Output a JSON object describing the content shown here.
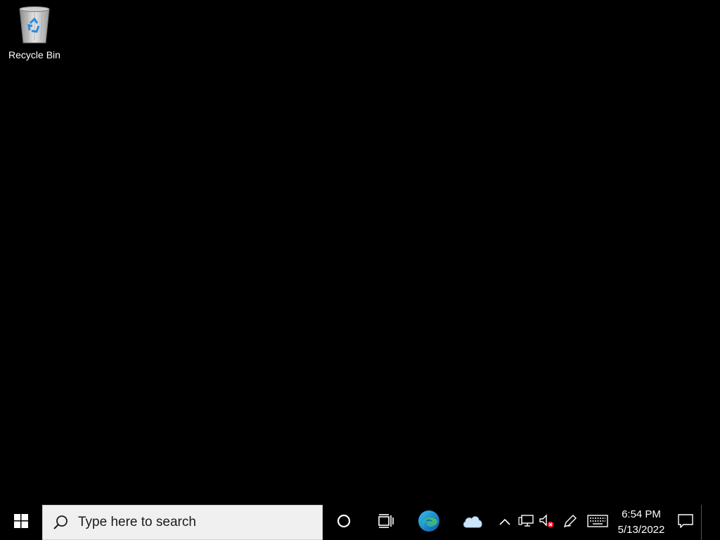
{
  "desktop": {
    "background_color": "#000000",
    "icons": [
      {
        "label": "Recycle Bin",
        "icon": "recycle-bin-icon"
      }
    ]
  },
  "taskbar": {
    "start": {
      "icon": "windows-logo-icon"
    },
    "search": {
      "placeholder": "Type here to search",
      "icon": "search-icon"
    },
    "cortana": {
      "icon": "cortana-circle-icon"
    },
    "task_view": {
      "icon": "task-view-icon"
    },
    "pinned": [
      {
        "name": "Microsoft Edge",
        "icon": "edge-icon"
      },
      {
        "name": "OneDrive",
        "icon": "onedrive-cloud-icon"
      }
    ],
    "tray": {
      "icons": [
        "show-hidden-icons-chevron",
        "network-icon",
        "volume-muted-icon",
        "pen-icon",
        "touch-keyboard-icon"
      ],
      "clock": {
        "time": "6:54 PM",
        "date": "5/13/2022"
      },
      "notification_icon": "action-center-icon"
    },
    "colors": {
      "taskbar_bg": "#000000",
      "search_bg": "#f0f0f0",
      "edge_blue": "#0c59a4",
      "edge_green": "#52c24c",
      "mute_red": "#e81123"
    }
  }
}
